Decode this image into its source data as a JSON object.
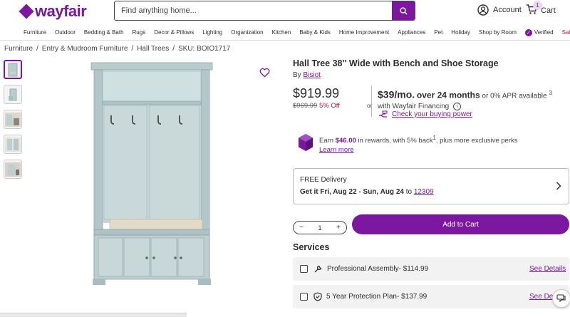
{
  "brand": {
    "logo_text": "wayfair",
    "color": "#7b189f"
  },
  "search": {
    "placeholder": "Find anything home..."
  },
  "header": {
    "account_label": "Account",
    "cart_label": "Cart",
    "cart_count": "1"
  },
  "nav": {
    "items": [
      "Furniture",
      "Outdoor",
      "Bedding & Bath",
      "Rugs",
      "Decor & Pillows",
      "Lighting",
      "Organization",
      "Kitchen",
      "Baby & Kids",
      "Home Improvement",
      "Appliances",
      "Pet",
      "Holiday",
      "Shop by Room"
    ],
    "verified_label": "Verified",
    "sale_label": "Sale"
  },
  "breadcrumb": {
    "items": [
      "Furniture",
      "Entry & Mudroom Furniture",
      "Hall Trees"
    ],
    "sku": "SKU: BOIO1717"
  },
  "product": {
    "title": "Hall Tree 38'' Wide with Bench and Shoe Storage",
    "by_label": "By",
    "brand": "Bisiot",
    "price": "$919.99",
    "was_price": "$969.99",
    "discount": "5% Off"
  },
  "financing": {
    "or_label": "or",
    "monthly": "$39/mo.",
    "term": "over 24 months",
    "apr_text": "or 0% APR available",
    "sup": "3",
    "with_text": "with Wayfair Financing",
    "buying_power_link": "Check your buying power"
  },
  "rewards": {
    "prefix": "Earn",
    "amount": "$46.00",
    "text": "in rewards, with 5% back",
    "sup": "1",
    "suffix": ", plus more exclusive perks",
    "link": "Learn more"
  },
  "delivery": {
    "label": "FREE Delivery",
    "dates": "Get it Fri, Aug 22 - Sun, Aug 24",
    "to": "to",
    "zip": "12309"
  },
  "quantity": {
    "value": "1",
    "minus": "−",
    "plus": "+"
  },
  "add_to_cart": "Add to Cart",
  "services": {
    "title": "Services",
    "items": [
      {
        "label": "Professional Assembly- $114.99",
        "link": "See Details",
        "icon": "wrench-icon"
      },
      {
        "label": "5 Year Protection Plan- $137.99",
        "link": "See Det",
        "icon": "shield-icon"
      }
    ]
  }
}
